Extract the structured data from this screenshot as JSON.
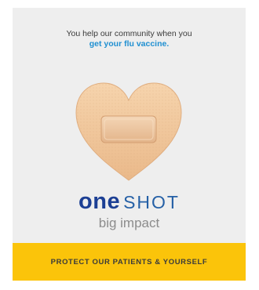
{
  "intro": {
    "line1": "You help our community when you",
    "line2": "get your flu vaccine."
  },
  "brand": {
    "word1": "one",
    "word2": "SHOT",
    "tagline": "big impact"
  },
  "banner": {
    "text": "PROTECT OUR PATIENTS & YOURSELF"
  },
  "colors": {
    "card_background": "#eeeeee",
    "highlight_blue": "#1f8fd1",
    "brand_blue": "#1c3f94",
    "banner_yellow": "#fbc40a",
    "bandage_tan": "#f2c89a"
  },
  "icons": {
    "illustration": "heart-bandage-icon"
  }
}
